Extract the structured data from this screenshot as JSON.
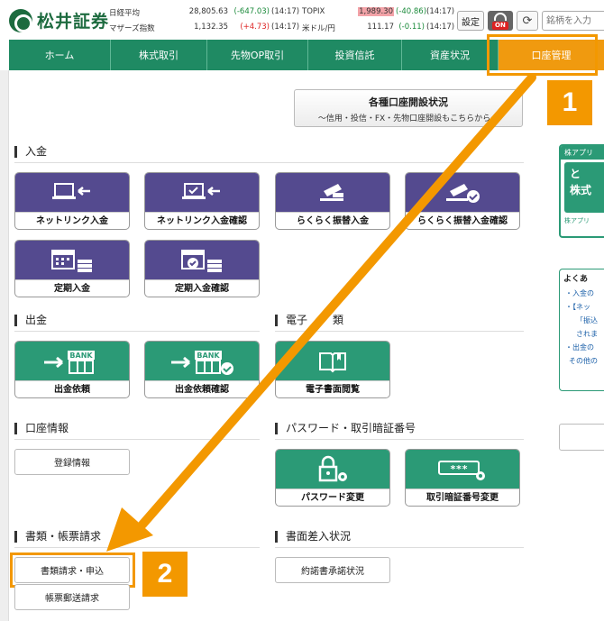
{
  "brand": {
    "name": "松井証券"
  },
  "tickers": [
    {
      "label": "日経平均",
      "value": "28,805.63",
      "change": "(-647.03)",
      "time": "(14:17)",
      "name": "TOPIX",
      "value2": "1,989.30",
      "change2": "(-40.86)",
      "time2": "(14:17)"
    },
    {
      "label": "マザーズ指数",
      "value": "1,132.35",
      "change": "(+4.73)",
      "time": "(14:17)",
      "name": "米ドル/円",
      "value2": "111.17",
      "change2": "(-0.11)",
      "time2": "(14:17)"
    }
  ],
  "header": {
    "settings_label": "設定",
    "on_label": "ON",
    "search_placeholder": "銘柄を入力"
  },
  "nav": {
    "items": [
      "ホーム",
      "株式取引",
      "先物OP取引",
      "投資信託",
      "資産状況",
      "口座管理"
    ]
  },
  "status_button": {
    "title": "各種口座開設状況",
    "subtitle": "～信用・投信・FX・先物口座開設もこちらから～"
  },
  "sections": {
    "deposit": {
      "title": "入金",
      "tiles": [
        "ネットリンク入金",
        "ネットリンク入金確認",
        "らくらく振替入金",
        "らくらく振替入金確認",
        "定期入金",
        "定期入金確認"
      ]
    },
    "withdraw": {
      "title": "出金",
      "tiles": [
        "出金依頼",
        "出金依頼確認"
      ],
      "bank_label": "BANK"
    },
    "edoc": {
      "title": "電子書類",
      "title_visible": "電子",
      "title_tail": "類",
      "tiles": [
        "電子書面閲覧"
      ]
    },
    "account_info": {
      "title": "口座情報",
      "buttons": [
        "登録情報"
      ]
    },
    "password": {
      "title": "パスワード・取引暗証番号",
      "tiles": [
        "パスワード変更",
        "取引暗証番号変更"
      ],
      "pin_mask": "***"
    },
    "documents": {
      "title": "書類・帳票請求",
      "buttons": [
        "書類請求・申込",
        "帳票郵送請求"
      ]
    },
    "submission": {
      "title": "書面差入状況",
      "buttons": [
        "約諾書承諾状況"
      ]
    }
  },
  "side": {
    "panel_head": "株アプリ",
    "panel_body_1": "と",
    "panel_body_2": "株式",
    "panel_foot": "株アプリ",
    "faq_title": "よくあ",
    "faq_items": [
      "・入金の",
      "・【ネッ",
      "「振込",
      "されま",
      "・出金の",
      "その他の"
    ]
  },
  "callouts": {
    "step1": "1",
    "step2": "2"
  },
  "colors": {
    "brand_green": "#1f8a63",
    "accent_orange": "#f39800",
    "tile_purple": "#544a8f",
    "tile_green": "#2b9a76"
  }
}
